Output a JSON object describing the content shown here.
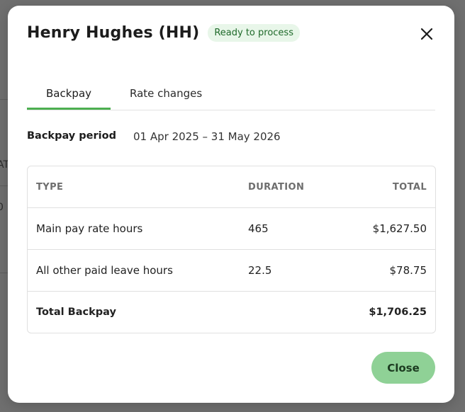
{
  "background": {
    "partial_text_1": "AT",
    "partial_text_2": "0"
  },
  "modal": {
    "title": "Henry Hughes (HH)",
    "status_badge": "Ready to process",
    "tabs": [
      {
        "label": "Backpay",
        "active": true
      },
      {
        "label": "Rate changes",
        "active": false
      }
    ],
    "backpay_period": {
      "label": "Backpay period",
      "value": "01 Apr 2025 – 31 May 2026"
    },
    "table": {
      "headers": {
        "type": "TYPE",
        "duration": "DURATION",
        "total": "TOTAL"
      },
      "rows": [
        {
          "type": "Main pay rate hours",
          "duration": "465",
          "total": "$1,627.50"
        },
        {
          "type": "All other paid leave hours",
          "duration": "22.5",
          "total": "$78.75"
        }
      ],
      "footer": {
        "label": "Total Backpay",
        "total": "$1,706.25"
      }
    },
    "close_label": "Close"
  },
  "colors": {
    "accent": "#4caf50",
    "badge_bg": "#e8f6e9",
    "close_button_bg": "#8fd196"
  }
}
